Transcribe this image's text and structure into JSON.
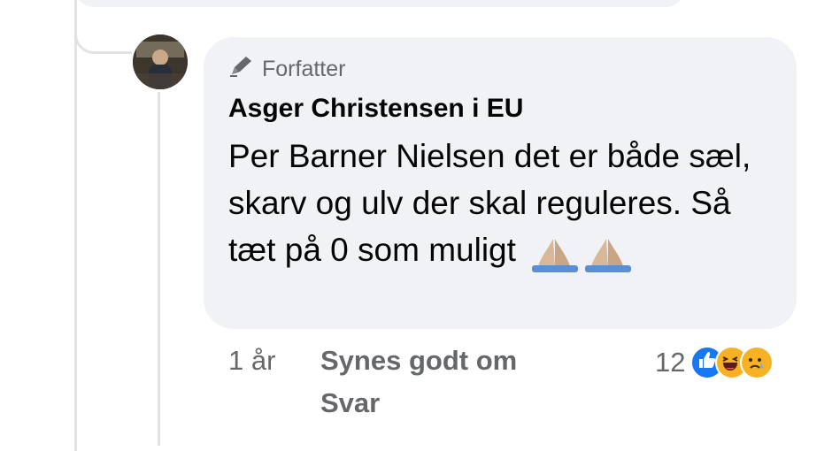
{
  "comment": {
    "badge_label": "Forfatter",
    "author": "Asger Christensen i EU",
    "text": "Per Barner Nielsen det er både sæl, skarv og ulv der skal reguleres. Så tæt på 0 som muligt",
    "emoji": "🙏🙏"
  },
  "actions": {
    "time": "1 år",
    "like_label": "Synes godt om",
    "reply_label": "Svar"
  },
  "reactions": {
    "count": "12",
    "types": [
      "like-icon",
      "haha-icon",
      "sad-icon"
    ],
    "colors": {
      "like": "#1877f2",
      "haha": "#f7b125",
      "sad": "#f7b125"
    }
  }
}
